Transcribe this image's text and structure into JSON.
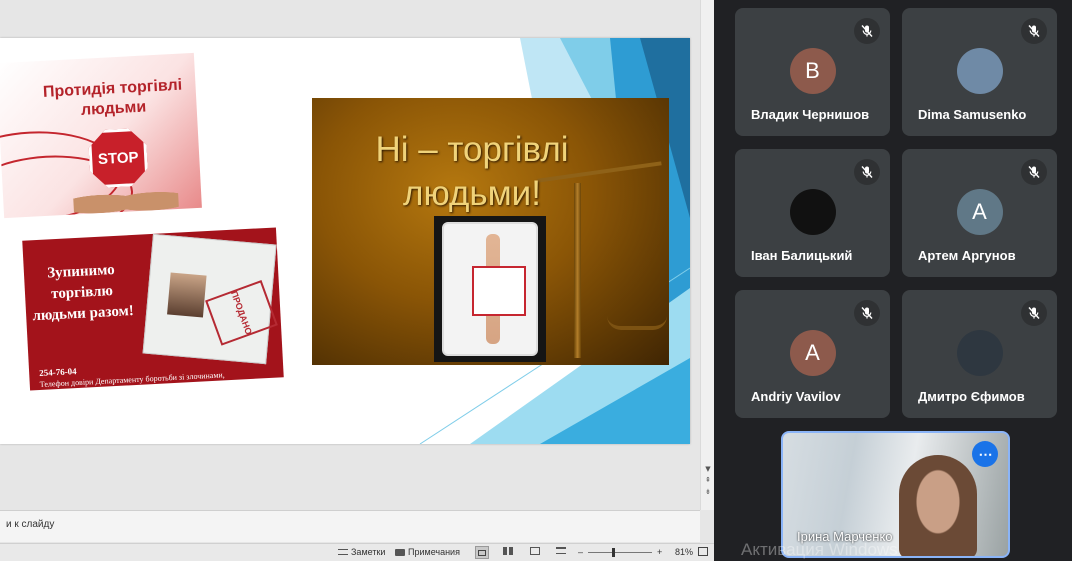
{
  "powerpoint": {
    "slide": {
      "card1_title": "Протидія торгівлі людьми",
      "stop_text": "STOP",
      "card2_title": "Зупинимо торгівлю людьми разом!",
      "card2_phone": "254-76-04",
      "card2_footer": "Телефон довіри Департаменту боротьби зі злочинами, пов'язаними з торгівлею людьми, МВС України",
      "stamp_text": "ПРОДАНО",
      "poster_title": "Ні – торгівлі людьми!"
    },
    "notes_placeholder": "и к слайду",
    "status": {
      "notes_label": "Заметки",
      "comments_label": "Примечания",
      "zoom_minus": "–",
      "zoom_plus": "+",
      "zoom_level": "81%"
    }
  },
  "meet": {
    "participants": [
      {
        "name": "Владик Чернишов",
        "initial": "В",
        "color": "#8d5a4c"
      },
      {
        "name": "Dima Samusenko",
        "initial": "",
        "color": "#6f8aa6"
      },
      {
        "name": "Іван Балицький",
        "initial": "",
        "color": "#111111"
      },
      {
        "name": "Артем Аргунов",
        "initial": "А",
        "color": "#607887"
      },
      {
        "name": "Andriy Vavilov",
        "initial": "A",
        "color": "#8d5a4c"
      },
      {
        "name": "Дмитро Єфимов",
        "initial": "",
        "color": "#2e3740"
      }
    ],
    "self": {
      "name": "Ірина Марченко",
      "more_icon": "⋯"
    },
    "colors": {
      "tile_bg": "#3c4043",
      "panel_bg": "#202124",
      "accent": "#8ab4f8",
      "button_blue": "#1a73e8"
    }
  },
  "windows_watermark": "Активация Windows"
}
